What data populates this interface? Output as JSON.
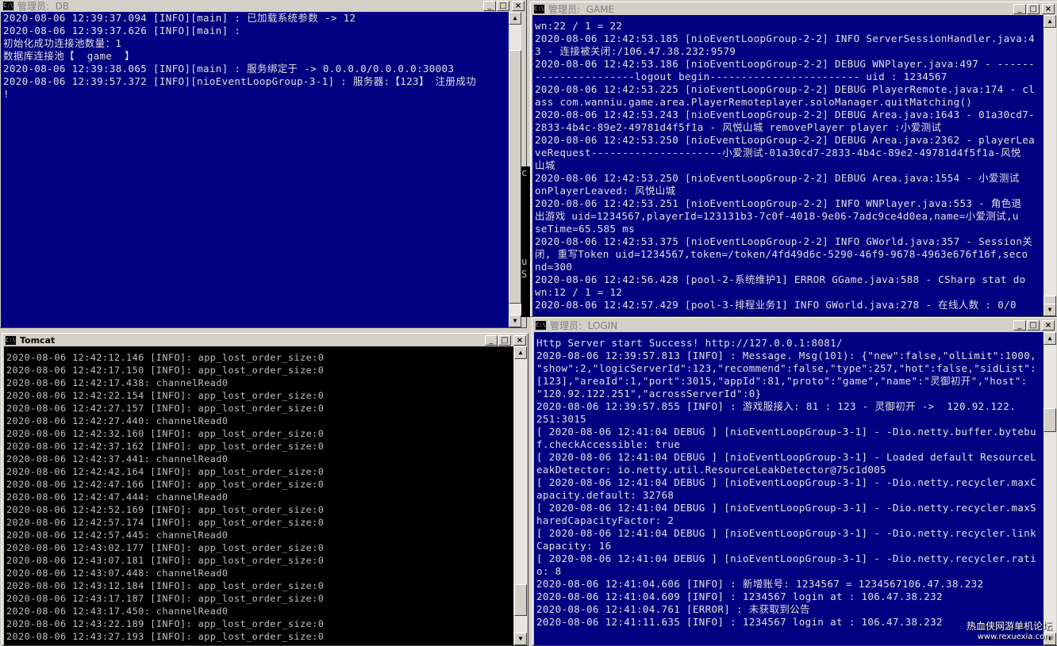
{
  "windows": {
    "db": {
      "title": "管理员:  DB",
      "lines": [
        "2020-08-06 12:39:37.094 [INFO][main] : 已加载系统参数 -> 12",
        "2020-08-06 12:39:37.626 [INFO][main] :",
        "",
        "初始化成功连接池数量：1",
        "数据库连接池【  game  】",
        "",
        "2020-08-06 12:39:38.065 [INFO][main] : 服务绑定于 -> 0.0.0.0/0.0.0.0:30003",
        "2020-08-06 12:39:57.372 [INFO][nioEventLoopGroup-3-1] : 服务器:【123】 注册成功",
        "!"
      ]
    },
    "game": {
      "title": "管理员:  GAME",
      "lines": [
        "wn:22 / 1 = 22",
        "2020-08-06 12:42:53.185 [nioEventLoopGroup-2-2] INFO ServerSessionHandler.java:4",
        "3 - 连接被关闭:/106.47.38.232:9579",
        "2020-08-06 12:42:53.186 [nioEventLoopGroup-2-2] DEBUG WNPlayer.java:497 - ------",
        "----------------logout begin------------------------ uid : 1234567",
        "2020-08-06 12:42:53.225 [nioEventLoopGroup-2-2] DEBUG PlayerRemote.java:174 - cl",
        "ass com.wanniu.game.area.PlayerRemoteplayer.soloManager.quitMatching()",
        "2020-08-06 12:42:53.243 [nioEventLoopGroup-2-2] DEBUG Area.java:1643 - 01a30cd7-",
        "2833-4b4c-89e2-49781d4f5f1a - 风悦山城 removePlayer player :小爱测试",
        "2020-08-06 12:42:53.250 [nioEventLoopGroup-2-2] DEBUG Area.java:2362 - playerLea",
        "veRequest---------------------小爱测试-01a30cd7-2833-4b4c-89e2-49781d4f5f1a-风悦",
        "山城",
        "2020-08-06 12:42:53.250 [nioEventLoopGroup-2-2] DEBUG Area.java:1554 - 小爱测试",
        "onPlayerLeaved: 风悦山城",
        "2020-08-06 12:42:53.251 [nioEventLoopGroup-2-2] INFO WNPlayer.java:553 - 角色退",
        "出游戏 uid=1234567,playerId=123131b3-7c0f-4018-9e06-7adc9ce4d0ea,name=小爱测试,u",
        "seTime=65.585 ms",
        "2020-08-06 12:42:53.375 [nioEventLoopGroup-2-2] INFO GWorld.java:357 - Session关",
        "闭, 重写Token uid=1234567,token=/token/4fd49d6c-5290-46f9-9678-4963e676f16f,seco",
        "nd=300",
        "2020-08-06 12:42:56.428 [pool-2-系统维护1] ERROR GGame.java:588 - CSharp stat do",
        "wn:12 / 1 = 12",
        "2020-08-06 12:42:57.429 [pool-3-排程业务1] INFO GWorld.java:278 - 在线人数 : 0/0"
      ]
    },
    "tomcat": {
      "title": "Tomcat",
      "lines": [
        "2020-08-06 12:42:12.146 [INFO]: app_lost_order_size:0",
        "2020-08-06 12:42:17.150 [INFO]: app_lost_order_size:0",
        "2020-08-06 12:42:17.438: channelRead0",
        "2020-08-06 12:42:22.154 [INFO]: app_lost_order_size:0",
        "2020-08-06 12:42:27.157 [INFO]: app_lost_order_size:0",
        "2020-08-06 12:42:27.440: channelRead0",
        "2020-08-06 12:42:32.160 [INFO]: app_lost_order_size:0",
        "2020-08-06 12:42:37.162 [INFO]: app_lost_order_size:0",
        "2020-08-06 12:42:37.441: channelRead0",
        "2020-08-06 12:42:42.164 [INFO]: app_lost_order_size:0",
        "2020-08-06 12:42:47.166 [INFO]: app_lost_order_size:0",
        "2020-08-06 12:42:47.444: channelRead0",
        "2020-08-06 12:42:52.169 [INFO]: app_lost_order_size:0",
        "2020-08-06 12:42:57.174 [INFO]: app_lost_order_size:0",
        "2020-08-06 12:42:57.445: channelRead0",
        "2020-08-06 12:43:02.177 [INFO]: app_lost_order_size:0",
        "2020-08-06 12:43:07.181 [INFO]: app_lost_order_size:0",
        "2020-08-06 12:43:07.448: channelRead0",
        "2020-08-06 12:43:12.184 [INFO]: app_lost_order_size:0",
        "2020-08-06 12:43:17.187 [INFO]: app_lost_order_size:0",
        "2020-08-06 12:43:17.450: channelRead0",
        "2020-08-06 12:43:22.189 [INFO]: app_lost_order_size:0",
        "2020-08-06 12:43:27.193 [INFO]: app_lost_order_size:0"
      ]
    },
    "login": {
      "title": "管理员:  LOGIN",
      "lines": [
        "",
        "Http Server start Success! http://127.0.0.1:8081/",
        "2020-08-06 12:39:57.813 [INFO] : Message. Msg(101): {\"new\":false,\"olLimit\":1000,",
        "\"show\":2,\"logicServerId\":123,\"recommend\":false,\"type\":257,\"hot\":false,\"sidList\":",
        "[123],\"areaId\":1,\"port\":3015,\"appId\":81,\"proto\":\"game\",\"name\":\"灵御初开\",\"host\":",
        "\"120.92.122.251\",\"acrossServerId\":0}",
        "2020-08-06 12:39:57.855 [INFO] : 游戏服接入: 81 : 123 - 灵御初开 ->  120.92.122.",
        "251:3015",
        "[ 2020-08-06 12:41:04 DEBUG ] [nioEventLoopGroup-3-1] - -Dio.netty.buffer.bytebu",
        "f.checkAccessible: true",
        "[ 2020-08-06 12:41:04 DEBUG ] [nioEventLoopGroup-3-1] - Loaded default ResourceL",
        "eakDetector: io.netty.util.ResourceLeakDetector@75c1d005",
        "[ 2020-08-06 12:41:04 DEBUG ] [nioEventLoopGroup-3-1] - -Dio.netty.recycler.maxC",
        "apacity.default: 32768",
        "[ 2020-08-06 12:41:04 DEBUG ] [nioEventLoopGroup-3-1] - -Dio.netty.recycler.maxS",
        "haredCapacityFactor: 2",
        "[ 2020-08-06 12:41:04 DEBUG ] [nioEventLoopGroup-3-1] - -Dio.netty.recycler.link",
        "Capacity: 16",
        "[ 2020-08-06 12:41:04 DEBUG ] [nioEventLoopGroup-3-1] - -Dio.netty.recycler.rati",
        "o: 8",
        "2020-08-06 12:41:04.606 [INFO] : 新增账号: 1234567 = 1234567106.47.38.232",
        "2020-08-06 12:41:04.609 [INFO] : 1234567 login at : 106.47.38.232",
        "2020-08-06 12:41:04.761 [ERROR] : 未获取到公告",
        "2020-08-06 12:41:11.635 [INFO] : 1234567 login at : 106.47.38.232"
      ]
    }
  },
  "behind_window_chars": [
    "c",
    "",
    "",
    "",
    "",
    "",
    "",
    "u",
    "S",
    "",
    "",
    ""
  ],
  "watermark": {
    "main": "热血侠网游单机论坛",
    "url": "www.rexuexia.com"
  },
  "colors": {
    "console_blue": "#000080",
    "console_black": "#000000"
  }
}
